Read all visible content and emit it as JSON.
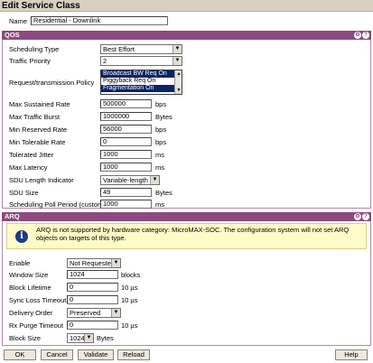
{
  "title": "Edit Service Class",
  "name": {
    "label": "Name",
    "value": "Residential - Downlink"
  },
  "qos": {
    "header": "QOS",
    "scheduling_type": {
      "label": "Scheduling Type",
      "value": "Best Effort"
    },
    "traffic_priority": {
      "label": "Traffic Priority",
      "value": "2"
    },
    "request_policy": {
      "label": "Request/transmission Policy",
      "options": [
        {
          "text": "Broadcast BW Req On",
          "selected": true
        },
        {
          "text": "Piggyback Req On",
          "selected": false
        },
        {
          "text": "Fragmentation On",
          "selected": true
        }
      ]
    },
    "max_sustained_rate": {
      "label": "Max Sustained Rate",
      "value": "500000",
      "unit": "bps"
    },
    "max_traffic_burst": {
      "label": "Max Traffic Burst",
      "value": "1000000",
      "unit": "Bytes"
    },
    "min_reserved_rate": {
      "label": "Min Reserved Rate",
      "value": "56000",
      "unit": "bps"
    },
    "min_tolerable_rate": {
      "label": "Min Tolerable Rate",
      "value": "0",
      "unit": "bps"
    },
    "tolerated_jitter": {
      "label": "Tolerated Jitter",
      "value": "1000",
      "unit": "ms"
    },
    "max_latency": {
      "label": "Max Latency",
      "value": "1000",
      "unit": "ms"
    },
    "sdu_length_indicator": {
      "label": "SDU Length Indicator",
      "value": "Variable-length"
    },
    "sdu_size": {
      "label": "SDU Size",
      "value": "49",
      "unit": "Bytes"
    },
    "scheduling_poll_period": {
      "label": "Scheduling Poll Period (custom)",
      "value": "1000",
      "unit": "ms"
    }
  },
  "arq": {
    "header": "ARQ",
    "notice": "ARQ is not supported by hardware category: MicroMAX-SOC. The configuration system will not set ARQ objects on targets of this type.",
    "enable": {
      "label": "Enable",
      "value": "Not Requested"
    },
    "window_size": {
      "label": "Window Size",
      "value": "1024",
      "unit": "blocks"
    },
    "block_lifetime": {
      "label": "Block Lifetime",
      "value": "0",
      "unit": "10 µs"
    },
    "sync_loss_timeout": {
      "label": "Sync Loss Timeout",
      "value": "0",
      "unit": "10 µs"
    },
    "delivery_order": {
      "label": "Delivery Order",
      "value": "Preserved"
    },
    "rx_purge_timeout": {
      "label": "Rx Purge Timeout",
      "value": "0",
      "unit": "10 µs"
    },
    "block_size": {
      "label": "Block Size",
      "value": "1024",
      "unit": "Bytes"
    }
  },
  "header_icons": {
    "settings": "⚙",
    "help": "?"
  },
  "buttons": {
    "ok": "OK",
    "cancel": "Cancel",
    "validate": "Validate",
    "reload": "Reload",
    "help": "Help"
  },
  "colors": {
    "section_header": "#8c4a7e",
    "selection": "#0a246a",
    "notice_bg": "#fffbc8"
  }
}
